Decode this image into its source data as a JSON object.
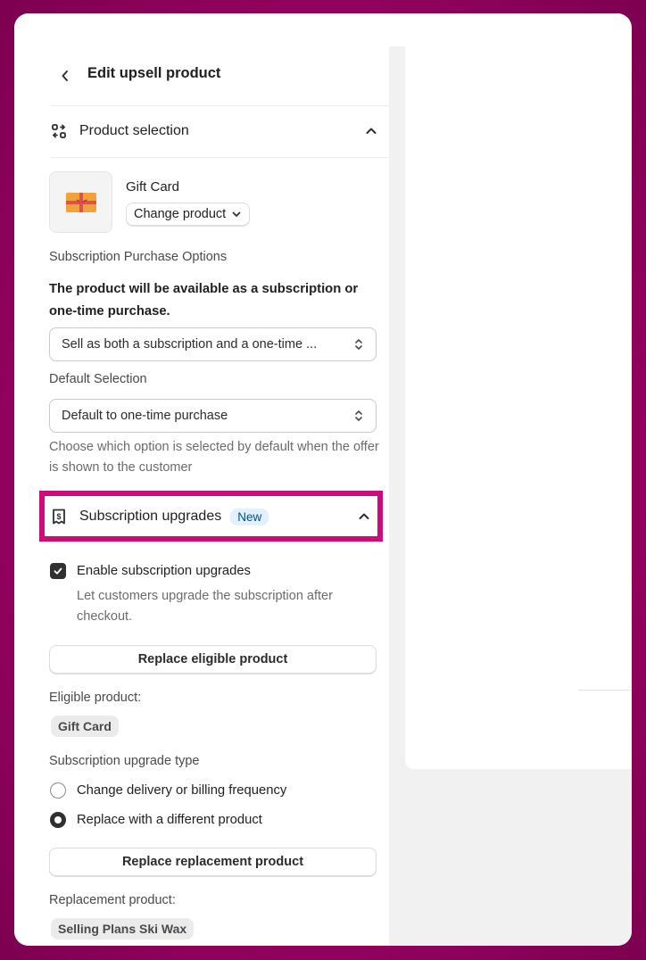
{
  "header": {
    "title": "Edit upsell product"
  },
  "product_selection": {
    "title": "Product selection",
    "product_name": "Gift Card",
    "change_product_label": "Change product",
    "purchase_options_label": "Subscription Purchase Options",
    "availability_text": "The product will be available as a subscription or one-time purchase.",
    "purchase_option_value": "Sell as both a subscription and a one-time ...",
    "default_selection_label": "Default Selection",
    "default_selection_value": "Default to one-time purchase",
    "default_help": "Choose which option is selected by default when the offer is shown to the customer"
  },
  "subscription_upgrades": {
    "title": "Subscription upgrades",
    "badge": "New",
    "enable_label": "Enable subscription upgrades",
    "enable_checked": true,
    "enable_help": "Let customers upgrade the subscription after checkout.",
    "replace_eligible_label": "Replace eligible product",
    "eligible_label": "Eligible product:",
    "eligible_value": "Gift Card",
    "upgrade_type_label": "Subscription upgrade type",
    "options": [
      {
        "label": "Change delivery or billing frequency",
        "selected": false
      },
      {
        "label": "Replace with a different product",
        "selected": true
      }
    ],
    "replace_replacement_label": "Replace replacement product",
    "replacement_label": "Replacement product:",
    "replacement_value": "Selling Plans Ski Wax"
  },
  "colors": {
    "highlight": "#cf0b7b",
    "background": "#a00468",
    "badge_bg": "#e0f0ff"
  },
  "icons": [
    "back-icon",
    "product-selection-icon",
    "chevron-up-icon",
    "chevron-down-icon",
    "select-updown-icon",
    "subscription-icon",
    "checkmark-icon"
  ]
}
